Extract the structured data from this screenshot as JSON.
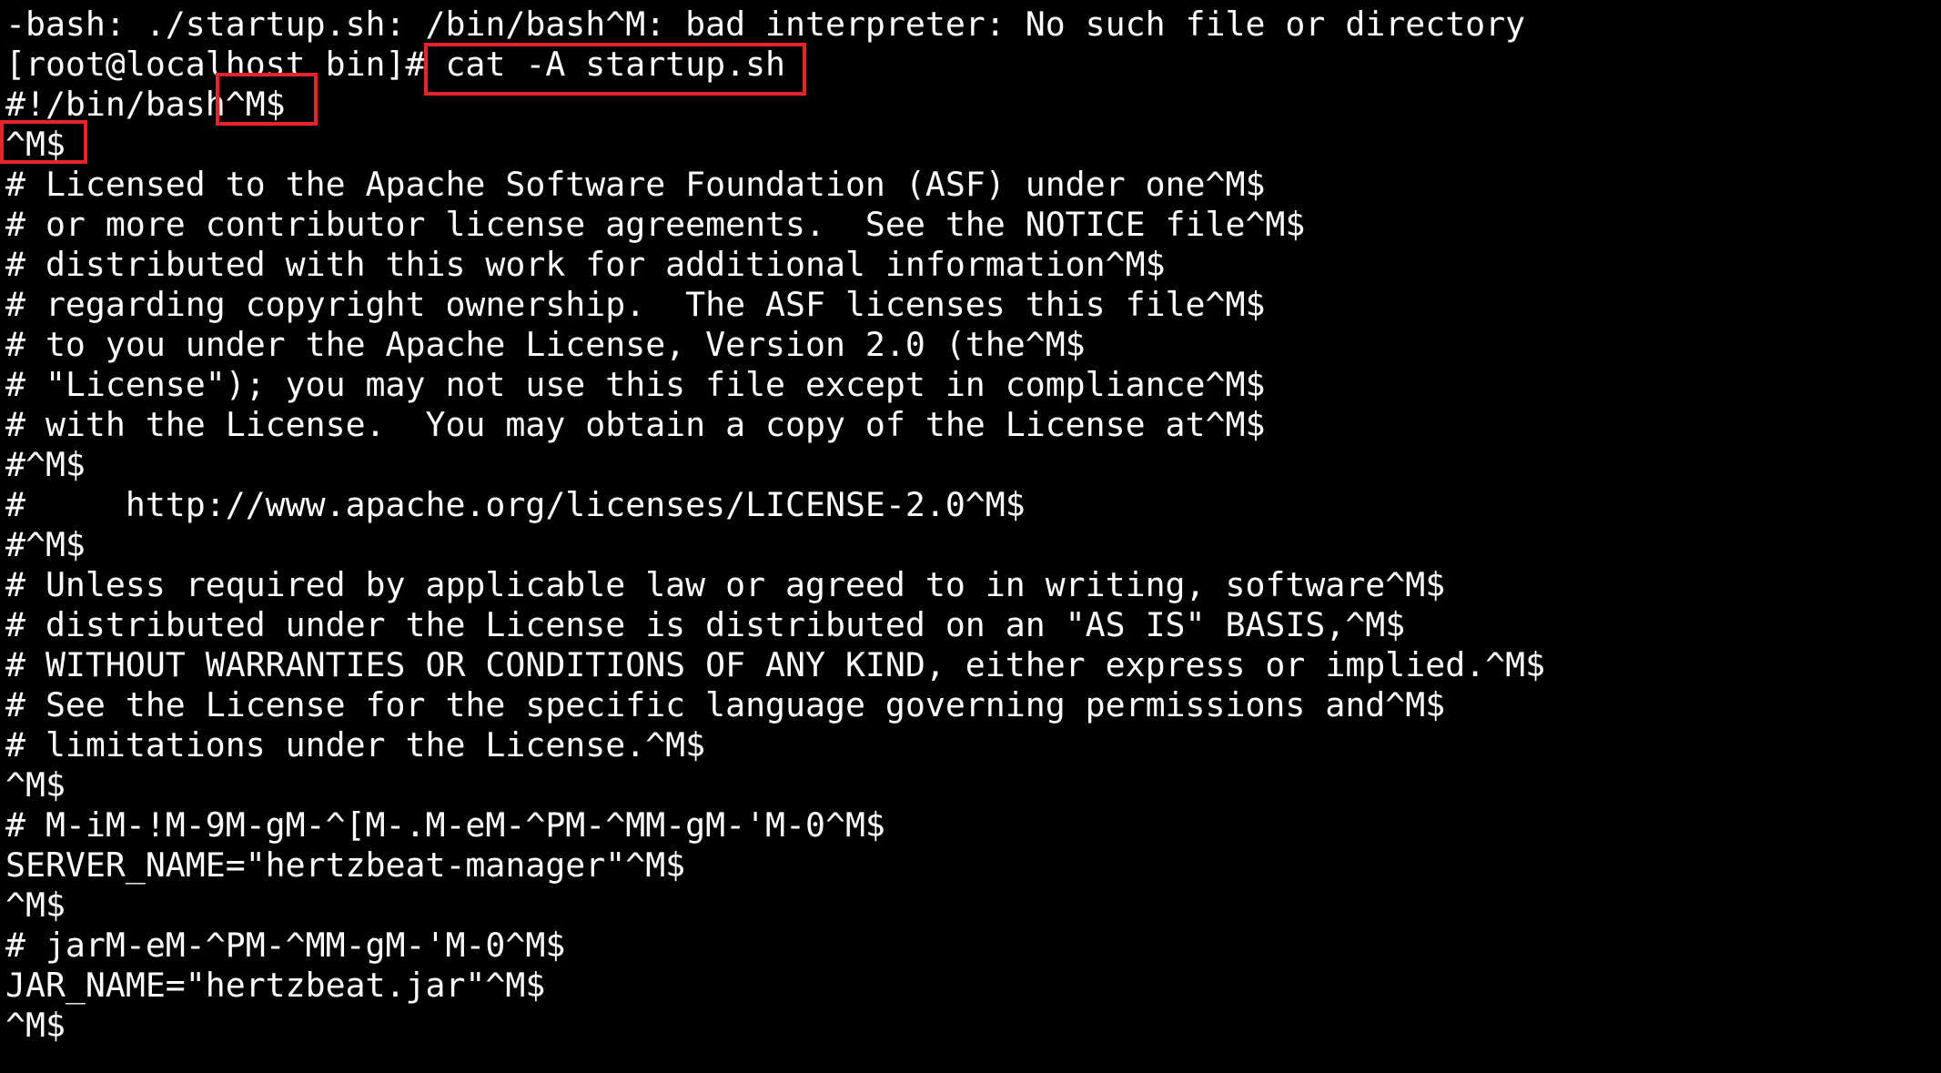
{
  "terminal": {
    "lines": [
      "-bash: ./startup.sh: /bin/bash^M: bad interpreter: No such file or directory",
      "[root@localhost bin]# cat -A startup.sh",
      "#!/bin/bash^M$",
      "^M$",
      "# Licensed to the Apache Software Foundation (ASF) under one^M$",
      "# or more contributor license agreements.  See the NOTICE file^M$",
      "# distributed with this work for additional information^M$",
      "# regarding copyright ownership.  The ASF licenses this file^M$",
      "# to you under the Apache License, Version 2.0 (the^M$",
      "# \"License\"); you may not use this file except in compliance^M$",
      "# with the License.  You may obtain a copy of the License at^M$",
      "#^M$",
      "#     http://www.apache.org/licenses/LICENSE-2.0^M$",
      "#^M$",
      "# Unless required by applicable law or agreed to in writing, software^M$",
      "# distributed under the License is distributed on an \"AS IS\" BASIS,^M$",
      "# WITHOUT WARRANTIES OR CONDITIONS OF ANY KIND, either express or implied.^M$",
      "# See the License for the specific language governing permissions and^M$",
      "# limitations under the License.^M$",
      "^M$",
      "# M-iM-!M-9M-gM-^[M-.M-eM-^PM-^MM-gM-'M-0^M$",
      "SERVER_NAME=\"hertzbeat-manager\"^M$",
      "^M$",
      "# jarM-eM-^PM-^MM-gM-'M-0^M$",
      "JAR_NAME=\"hertzbeat.jar\"^M$",
      "^M$"
    ]
  },
  "colors": {
    "background": "#000000",
    "foreground": "#ffffff",
    "highlight": "#e8232b"
  }
}
